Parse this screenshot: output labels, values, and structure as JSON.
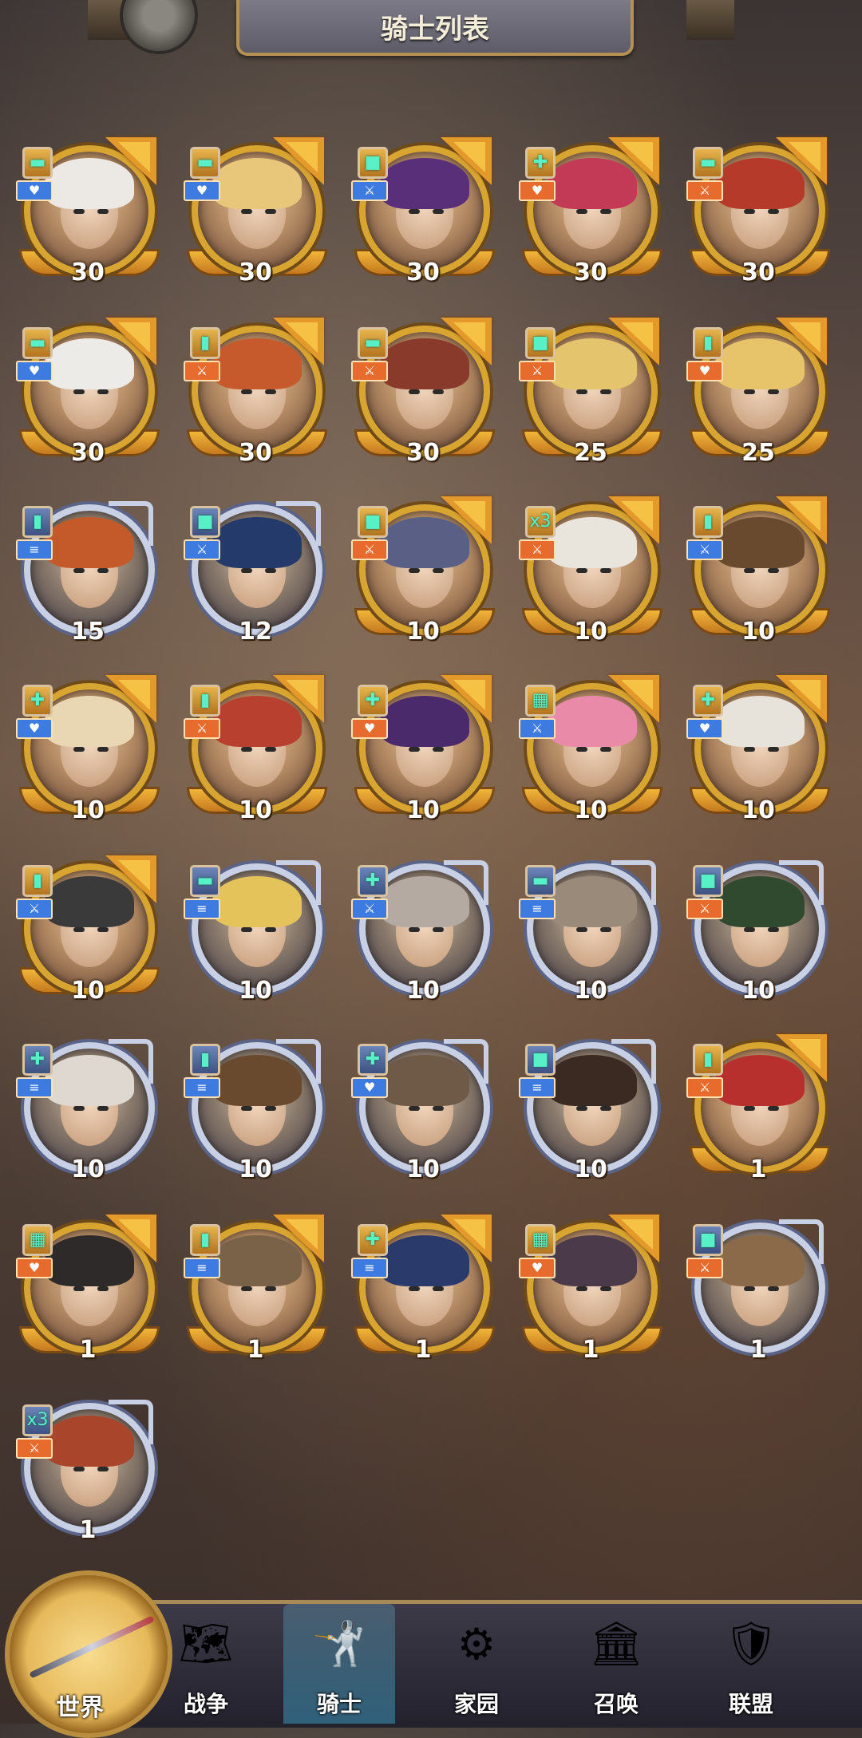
{
  "header": {
    "title": "骑士列表"
  },
  "colors": {
    "gold_frame": "#d9a531",
    "silver_frame": "#c8d0e6",
    "role_orange": "#e66b2c",
    "role_blue": "#3d7be0",
    "class_mint": "#58f0c6"
  },
  "knights": [
    {
      "level": "30",
      "rarity": "gold",
      "class_box": "gold",
      "class_glyph": "▬",
      "role": "blue",
      "role_glyph": "♥",
      "hair": "#ece9e4"
    },
    {
      "level": "30",
      "rarity": "gold",
      "class_box": "gold",
      "class_glyph": "▬",
      "role": "blue",
      "role_glyph": "♥",
      "hair": "#e9c77a"
    },
    {
      "level": "30",
      "rarity": "gold",
      "class_box": "gold",
      "class_glyph": "■",
      "role": "blue",
      "role_glyph": "⚔",
      "hair": "#5a2f7a"
    },
    {
      "level": "30",
      "rarity": "gold",
      "class_box": "gold",
      "class_glyph": "✚",
      "role": "orange",
      "role_glyph": "♥",
      "hair": "#c23a55"
    },
    {
      "level": "30",
      "rarity": "gold",
      "class_box": "gold",
      "class_glyph": "▬",
      "role": "orange",
      "role_glyph": "⚔",
      "hair": "#b63a2a"
    },
    {
      "level": "30",
      "rarity": "gold",
      "class_box": "gold",
      "class_glyph": "▬",
      "role": "blue",
      "role_glyph": "♥",
      "hair": "#ecebe8"
    },
    {
      "level": "30",
      "rarity": "gold",
      "class_box": "gold",
      "class_glyph": "▮",
      "role": "orange",
      "role_glyph": "⚔",
      "hair": "#c65a2c"
    },
    {
      "level": "30",
      "rarity": "gold",
      "class_box": "gold",
      "class_glyph": "▬",
      "role": "orange",
      "role_glyph": "⚔",
      "hair": "#8a3a2a"
    },
    {
      "level": "25",
      "rarity": "gold",
      "class_box": "gold",
      "class_glyph": "■",
      "role": "orange",
      "role_glyph": "⚔",
      "hair": "#e4c56e"
    },
    {
      "level": "25",
      "rarity": "gold",
      "class_box": "gold",
      "class_glyph": "▮",
      "role": "orange",
      "role_glyph": "♥",
      "hair": "#e7c46a"
    },
    {
      "level": "15",
      "rarity": "silver",
      "class_box": "blue",
      "class_glyph": "▮",
      "role": "blue",
      "role_glyph": "≡",
      "hair": "#c45a2a"
    },
    {
      "level": "12",
      "rarity": "silver",
      "class_box": "blue",
      "class_glyph": "■",
      "role": "blue",
      "role_glyph": "⚔",
      "hair": "#243a6a"
    },
    {
      "level": "10",
      "rarity": "gold",
      "class_box": "gold",
      "class_glyph": "■",
      "role": "orange",
      "role_glyph": "⚔",
      "hair": "#5a5f86"
    },
    {
      "level": "10",
      "rarity": "gold",
      "class_box": "gold",
      "class_glyph": "x3",
      "role": "orange",
      "role_glyph": "⚔",
      "hair": "#e9e4dc"
    },
    {
      "level": "10",
      "rarity": "gold",
      "class_box": "gold",
      "class_glyph": "▮",
      "role": "blue",
      "role_glyph": "⚔",
      "hair": "#6a4a2e"
    },
    {
      "level": "10",
      "rarity": "gold",
      "class_box": "gold",
      "class_glyph": "✚",
      "role": "blue",
      "role_glyph": "♥",
      "hair": "#e9d7b4"
    },
    {
      "level": "10",
      "rarity": "gold",
      "class_box": "gold",
      "class_glyph": "▮",
      "role": "orange",
      "role_glyph": "⚔",
      "hair": "#b8402e"
    },
    {
      "level": "10",
      "rarity": "gold",
      "class_box": "gold",
      "class_glyph": "✚",
      "role": "orange",
      "role_glyph": "♥",
      "hair": "#4a2a6a"
    },
    {
      "level": "10",
      "rarity": "gold",
      "class_box": "gold",
      "class_glyph": "▦",
      "role": "blue",
      "role_glyph": "⚔",
      "hair": "#e98aa8"
    },
    {
      "level": "10",
      "rarity": "gold",
      "class_box": "gold",
      "class_glyph": "✚",
      "role": "blue",
      "role_glyph": "♥",
      "hair": "#e7e2da"
    },
    {
      "level": "10",
      "rarity": "gold",
      "class_box": "gold",
      "class_glyph": "▮",
      "role": "blue",
      "role_glyph": "⚔",
      "hair": "#3a3a3a"
    },
    {
      "level": "10",
      "rarity": "silver",
      "class_box": "blue",
      "class_glyph": "▬",
      "role": "blue",
      "role_glyph": "≡",
      "hair": "#e4c45a"
    },
    {
      "level": "10",
      "rarity": "silver",
      "class_box": "blue",
      "class_glyph": "✚",
      "role": "blue",
      "role_glyph": "⚔",
      "hair": "#b5aaa2"
    },
    {
      "level": "10",
      "rarity": "silver",
      "class_box": "blue",
      "class_glyph": "▬",
      "role": "blue",
      "role_glyph": "≡",
      "hair": "#9a8a7a"
    },
    {
      "level": "10",
      "rarity": "silver",
      "class_box": "blue",
      "class_glyph": "■",
      "role": "orange",
      "role_glyph": "⚔",
      "hair": "#2f4a2f"
    },
    {
      "level": "10",
      "rarity": "silver",
      "class_box": "blue",
      "class_glyph": "✚",
      "role": "blue",
      "role_glyph": "≡",
      "hair": "#ded8d0"
    },
    {
      "level": "10",
      "rarity": "silver",
      "class_box": "blue",
      "class_glyph": "▮",
      "role": "blue",
      "role_glyph": "≡",
      "hair": "#6a4a2e"
    },
    {
      "level": "10",
      "rarity": "silver",
      "class_box": "blue",
      "class_glyph": "✚",
      "role": "blue",
      "role_glyph": "♥",
      "hair": "#6f5a48"
    },
    {
      "level": "10",
      "rarity": "silver",
      "class_box": "blue",
      "class_glyph": "■",
      "role": "blue",
      "role_glyph": "≡",
      "hair": "#3a2a22"
    },
    {
      "level": "1",
      "rarity": "gold",
      "class_box": "gold",
      "class_glyph": "▮",
      "role": "orange",
      "role_glyph": "⚔",
      "hair": "#b8302e"
    },
    {
      "level": "1",
      "rarity": "gold",
      "class_box": "gold",
      "class_glyph": "▦",
      "role": "orange",
      "role_glyph": "♥",
      "hair": "#2f2a2a"
    },
    {
      "level": "1",
      "rarity": "gold",
      "class_box": "gold",
      "class_glyph": "▮",
      "role": "blue",
      "role_glyph": "≡",
      "hair": "#7a6248"
    },
    {
      "level": "1",
      "rarity": "gold",
      "class_box": "gold",
      "class_glyph": "✚",
      "role": "blue",
      "role_glyph": "≡",
      "hair": "#2a3a6a"
    },
    {
      "level": "1",
      "rarity": "gold",
      "class_box": "gold",
      "class_glyph": "▦",
      "role": "orange",
      "role_glyph": "♥",
      "hair": "#4a3a4a"
    },
    {
      "level": "1",
      "rarity": "silver",
      "class_box": "blue",
      "class_glyph": "■",
      "role": "orange",
      "role_glyph": "⚔",
      "hair": "#8a6a48"
    },
    {
      "level": "1",
      "rarity": "silver",
      "class_box": "blue",
      "class_glyph": "x3",
      "role": "orange",
      "role_glyph": "⚔",
      "hair": "#a8452a"
    }
  ],
  "nav": {
    "world": {
      "label": "世界",
      "icon": "compass-icon"
    },
    "items": [
      {
        "label": "战争",
        "icon": "map-icon",
        "glyph": "🗺",
        "active": false
      },
      {
        "label": "骑士",
        "icon": "knight-icon",
        "glyph": "🤺",
        "active": true
      },
      {
        "label": "家园",
        "icon": "home-gear-icon",
        "glyph": "⚙",
        "active": false
      },
      {
        "label": "召唤",
        "icon": "summon-icon",
        "glyph": "🏛",
        "active": false
      },
      {
        "label": "联盟",
        "icon": "alliance-shield-icon",
        "glyph": "🛡",
        "active": false
      }
    ]
  }
}
